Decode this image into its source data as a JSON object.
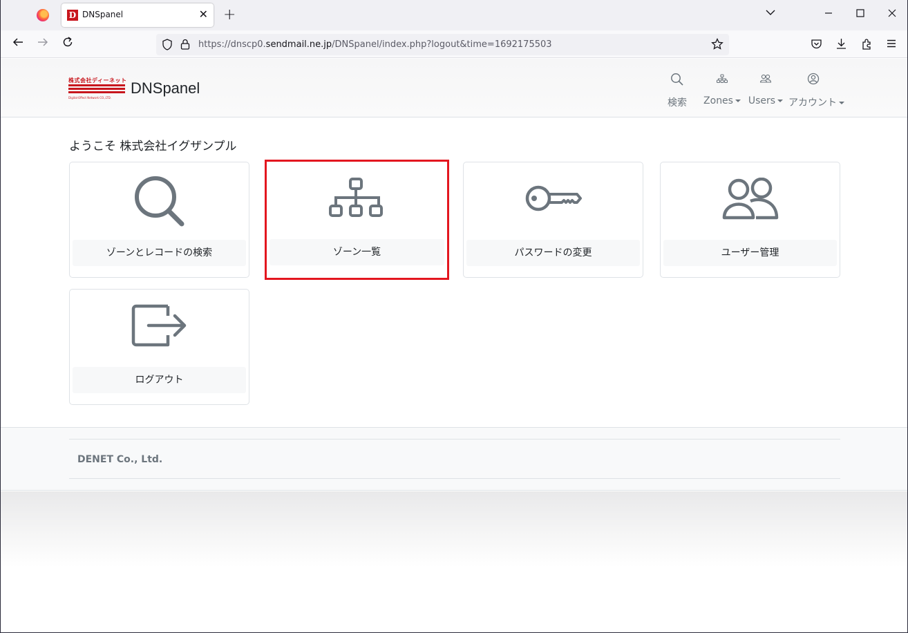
{
  "browser": {
    "tab_title": "DNSpanel",
    "tab_favicon": "D",
    "url_prefix": "https://dnscp0.",
    "url_host": "sendmail.ne.jp",
    "url_path": "/DNSpanel/index.php?logout&time=1692175503"
  },
  "header": {
    "logo_top": "株式会社ディーネット",
    "logo_bottom": "Digital-Effect Network CO.,LTD.",
    "brand": "DNSpanel",
    "nav": [
      {
        "label": "検索",
        "icon": "search-icon"
      },
      {
        "label": "Zones",
        "icon": "sitemap-icon"
      },
      {
        "label": "Users",
        "icon": "users-icon"
      },
      {
        "label": "アカウント",
        "icon": "user-circle-icon"
      }
    ]
  },
  "main": {
    "welcome": "ようこそ 株式会社イグザンプル",
    "cards": [
      {
        "label": "ゾーンとレコードの検索",
        "icon": "search-icon"
      },
      {
        "label": "ゾーン一覧",
        "icon": "sitemap-icon",
        "selected": true
      },
      {
        "label": "パスワードの変更",
        "icon": "key-icon"
      },
      {
        "label": "ユーザー管理",
        "icon": "users-icon"
      },
      {
        "label": "ログアウト",
        "icon": "logout-icon"
      }
    ]
  },
  "footer": {
    "copyright": "DENET Co., Ltd."
  },
  "colors": {
    "icon_gray": "#6c757d",
    "selected_border": "#e3161f",
    "brand_red": "#c8161d"
  }
}
